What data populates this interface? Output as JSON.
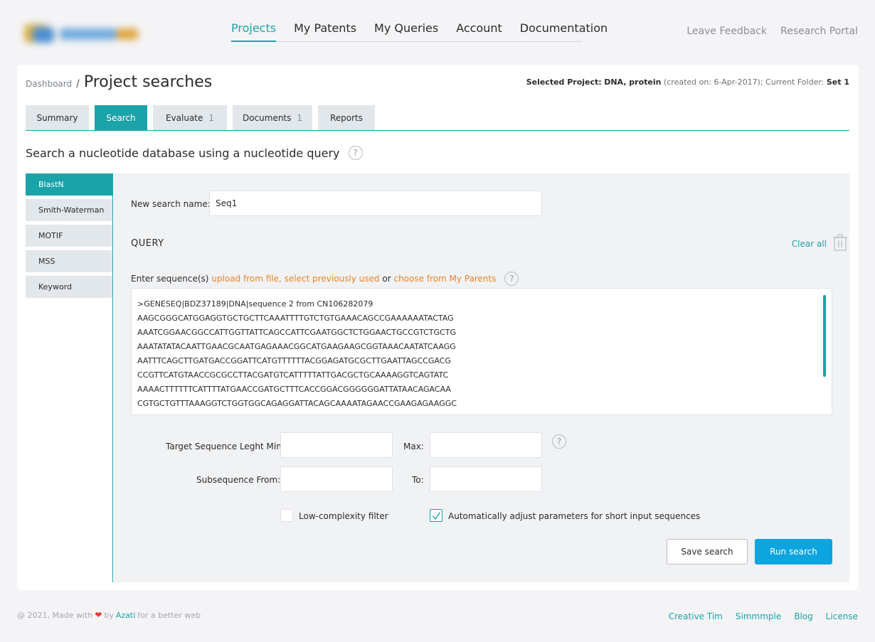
{
  "nav": {
    "items": [
      {
        "label": "Projects",
        "active": true
      },
      {
        "label": "My Patents",
        "active": false
      },
      {
        "label": "My Queries",
        "active": false
      },
      {
        "label": "Account",
        "active": false
      },
      {
        "label": "Documentation",
        "active": false
      }
    ],
    "right_links": [
      "Leave Feedback",
      "Research Portal"
    ]
  },
  "breadcrumb": {
    "parent": "Dashboard",
    "separator": "/",
    "title": "Project searches"
  },
  "project_info": {
    "prefix": "Selected Project:",
    "project": "DNA, protein",
    "created": "(created on: 6-Apr-2017); Current Folder:",
    "folder": "Set 1"
  },
  "tabs": [
    {
      "label": "Summary",
      "count": ""
    },
    {
      "label": "Search",
      "count": ""
    },
    {
      "label": "Evaluate",
      "count": "1"
    },
    {
      "label": "Documents",
      "count": "1"
    },
    {
      "label": "Reports",
      "count": ""
    }
  ],
  "heading": "Search a nucleotide database using a nucleotide query",
  "help_glyph": "?",
  "sidebar": [
    "BlastN",
    "Smith-Waterman",
    "MOTIF",
    "MSS",
    "Keyword"
  ],
  "form": {
    "name_label": "New search name:",
    "name_value": "Seq1",
    "query_title": "QUERY",
    "clear_all": "Clear all",
    "seq_prompt": "Enter sequence(s)",
    "link_upload": "upload from file",
    "link_select": "select previously used",
    "or_text": "or",
    "link_choose": "choose from My Parents",
    "sequence": ">GENESEQ|BDZ37189|DNA|sequence 2 from CN106282079\nAAGCGGGCATGGAGGTGCTGCTTCAAATTTTGTCTGTGAAACAGCCGAAAAAATACTAG\nAAATCGGAACGGCCATTGGTTATTCAGCCATTCGAATGGCTCTGGAACTGCCGTCTGCTG\nAAATATATACAATTGAACGCAATGAGAAACGGCATGAAGAAGCGGTAAACAATATCAAGG\nAATTTCAGCTTGATGACCGGATTCATGTTTTTTACGGAGATGCGCTTGAATTAGCCGACG\nCCGTTCATGTAACCGCGCCTTACGATGTCATTTTTATTGACGCTGCAAAAGGTCAGTATC\nAAAACTTTTTTCATTTTATGAACCGATGCTTTCACCGGACGGGGGGATTATAACAGACAA\nCGTGCTGTTTAAAGGTCTGGTGGCAGAGGATTACAGCAAAATAGAACCGAAGAGAAGGC",
    "min_label": "Target Sequence Leght Min:",
    "max_label": "Max:",
    "from_label": "Subsequence From:",
    "to_label": "To:",
    "low_complexity_label": "Low-complexity filter",
    "low_complexity_checked": false,
    "auto_adjust_label": "Automatically adjust parameters for short input sequences",
    "auto_adjust_checked": true,
    "save_label": "Save search",
    "run_label": "Run search"
  },
  "footer": {
    "prefix": "@ 2021, Made with",
    "by": "by",
    "brand": "Azati",
    "suffix": "for a better web",
    "links": [
      "Creative Tim",
      "Simmmple",
      "Blog",
      "License"
    ]
  },
  "colors": {
    "accent": "#1aa3a8",
    "link_orange": "#e8872a",
    "run_button": "#0da5e0"
  }
}
